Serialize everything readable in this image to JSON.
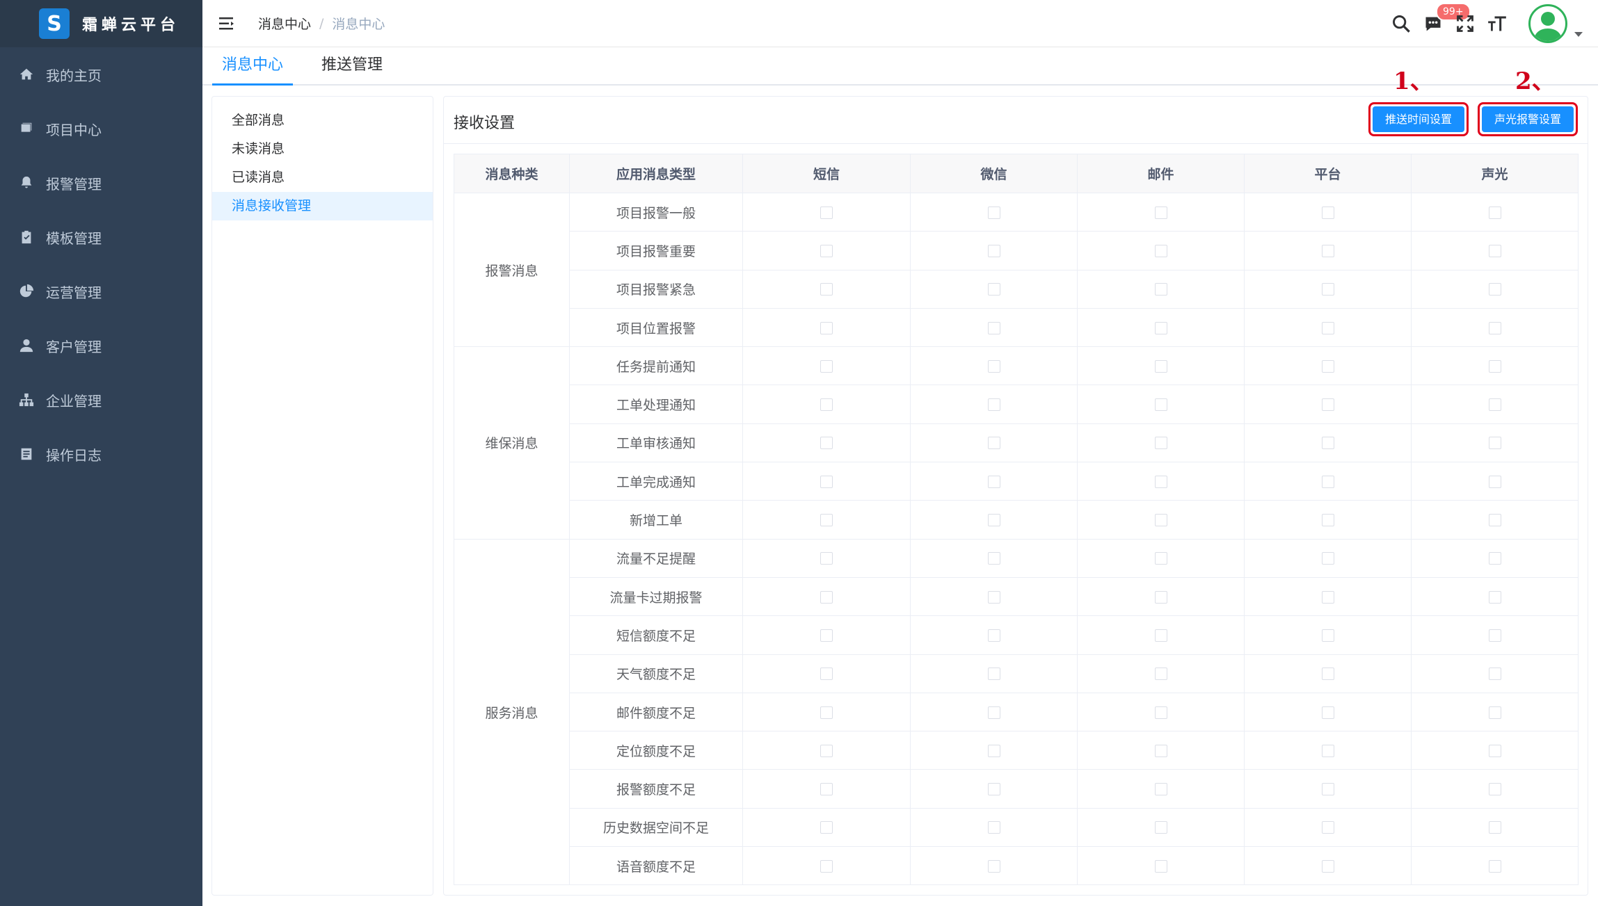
{
  "app": {
    "logo_letter": "S",
    "title": "霜蝉云平台"
  },
  "sidebar": {
    "items": [
      {
        "label": "我的主页",
        "icon": "home-icon"
      },
      {
        "label": "项目中心",
        "icon": "project-icon"
      },
      {
        "label": "报警管理",
        "icon": "bell-icon"
      },
      {
        "label": "模板管理",
        "icon": "clipboard-icon"
      },
      {
        "label": "运营管理",
        "icon": "pie-chart-icon"
      },
      {
        "label": "客户管理",
        "icon": "user-icon"
      },
      {
        "label": "企业管理",
        "icon": "org-icon"
      },
      {
        "label": "操作日志",
        "icon": "log-icon"
      }
    ]
  },
  "header": {
    "breadcrumb_first": "消息中心",
    "breadcrumb_sep": "/",
    "breadcrumb_last": "消息中心",
    "message_badge": "99+"
  },
  "tabs": [
    {
      "label": "消息中心",
      "active": true
    },
    {
      "label": "推送管理",
      "active": false
    }
  ],
  "subnav": [
    {
      "label": "全部消息",
      "active": false
    },
    {
      "label": "未读消息",
      "active": false
    },
    {
      "label": "已读消息",
      "active": false
    },
    {
      "label": "消息接收管理",
      "active": true
    }
  ],
  "card": {
    "title": "接收设置",
    "annotation_1": "1、",
    "annotation_2": "2、",
    "button_push_time": "推送时间设置",
    "button_alarm": "声光报警设置"
  },
  "table": {
    "headers": [
      "消息种类",
      "应用消息类型",
      "短信",
      "微信",
      "邮件",
      "平台",
      "声光"
    ],
    "groups": [
      {
        "category": "报警消息",
        "types": [
          "项目报警一般",
          "项目报警重要",
          "项目报警紧急",
          "项目位置报警"
        ]
      },
      {
        "category": "维保消息",
        "types": [
          "任务提前通知",
          "工单处理通知",
          "工单审核通知",
          "工单完成通知",
          "新增工单"
        ]
      },
      {
        "category": "服务消息",
        "types": [
          "流量不足提醒",
          "流量卡过期报警",
          "短信额度不足",
          "天气额度不足",
          "邮件额度不足",
          "定位额度不足",
          "报警额度不足",
          "历史数据空间不足",
          "语音额度不足"
        ]
      }
    ]
  },
  "colors": {
    "sidebar_bg": "#304156",
    "accent": "#1890ff",
    "annotation": "#d0021b",
    "badge": "#f56c6c"
  }
}
